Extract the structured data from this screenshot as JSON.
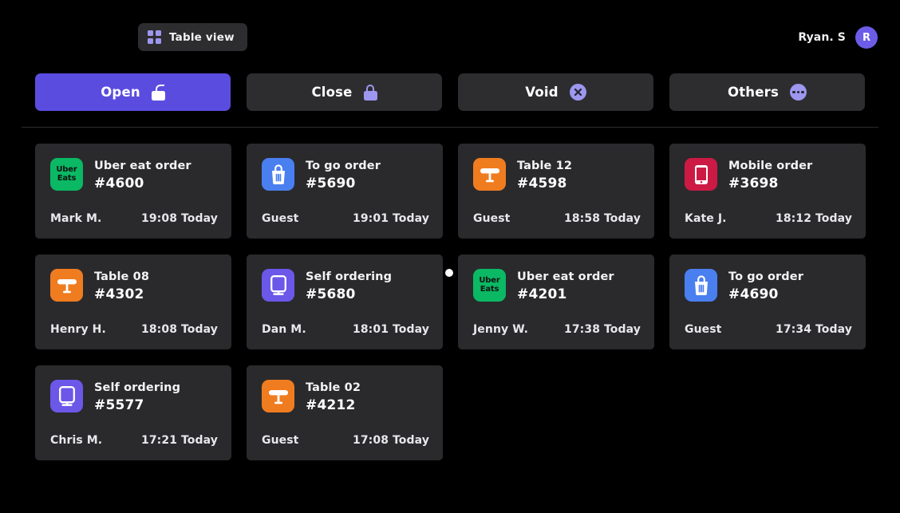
{
  "header": {
    "table_view_label": "Table view",
    "table_view_icon": "grid-icon",
    "user_name": "Ryan. S",
    "avatar_initial": "R"
  },
  "tabs": [
    {
      "label": "Open",
      "icon": "unlock-icon",
      "active": true
    },
    {
      "label": "Close",
      "icon": "lock-icon",
      "active": false
    },
    {
      "label": "Void",
      "icon": "x-circle-icon",
      "active": false
    },
    {
      "label": "Others",
      "icon": "ellipsis-circle-icon",
      "active": false
    }
  ],
  "colors": {
    "accent": "#5b4ce0",
    "accent_light": "#9d97ef",
    "background": "#000000",
    "card": "#2a2a2d",
    "ubereats": "#0bb864",
    "togo": "#4a7ff0",
    "table": "#f07c20",
    "mobile": "#cc1a44",
    "self": "#6b57e8"
  },
  "orders": [
    {
      "type": "ubereats",
      "name": "Uber eat order",
      "number": "#4600",
      "person": "Mark M.",
      "time": "19:08 Today",
      "icon": "ubereats-icon"
    },
    {
      "type": "togo",
      "name": "To go order",
      "number": "#5690",
      "person": "Guest",
      "time": "19:01 Today",
      "icon": "takeout-bag-icon"
    },
    {
      "type": "table",
      "name": "Table 12",
      "number": "#4598",
      "person": "Guest",
      "time": "18:58 Today",
      "icon": "table-icon"
    },
    {
      "type": "mobile",
      "name": "Mobile order",
      "number": "#3698",
      "person": "Kate J.",
      "time": "18:12 Today",
      "icon": "mobile-phone-icon"
    },
    {
      "type": "table",
      "name": "Table 08",
      "number": "#4302",
      "person": "Henry H.",
      "time": "18:08 Today",
      "icon": "table-icon"
    },
    {
      "type": "self",
      "name": "Self ordering",
      "number": "#5680",
      "person": "Dan M.",
      "time": "18:01 Today",
      "icon": "kiosk-icon"
    },
    {
      "type": "ubereats",
      "name": "Uber eat order",
      "number": "#4201",
      "person": "Jenny W.",
      "time": "17:38 Today",
      "icon": "ubereats-icon"
    },
    {
      "type": "togo",
      "name": "To go order",
      "number": "#4690",
      "person": "Guest",
      "time": "17:34 Today",
      "icon": "takeout-bag-icon"
    },
    {
      "type": "self",
      "name": "Self ordering",
      "number": "#5577",
      "person": "Chris M.",
      "time": "17:21 Today",
      "icon": "kiosk-icon"
    },
    {
      "type": "table",
      "name": "Table 02",
      "number": "#4212",
      "person": "Guest",
      "time": "17:08 Today",
      "icon": "table-icon"
    }
  ],
  "ubereats_logo": {
    "line1": "Uber",
    "line2": "Eats"
  }
}
